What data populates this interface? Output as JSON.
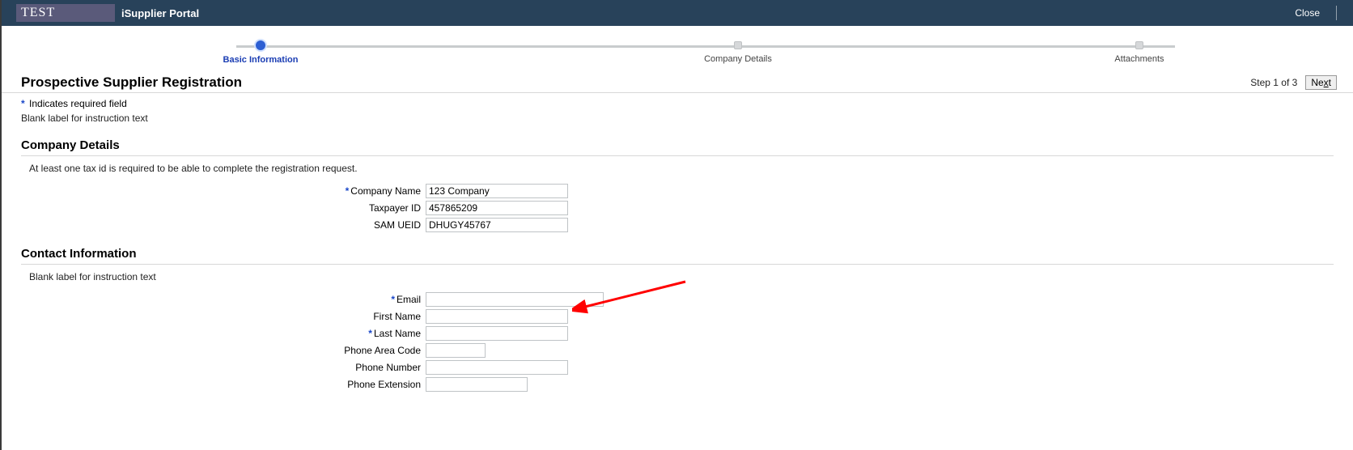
{
  "header": {
    "env_badge": "TEST",
    "portal_title": "iSupplier Portal",
    "close_label": "Close"
  },
  "progress": {
    "step1": "Basic Information",
    "step2": "Company Details",
    "step3": "Attachments"
  },
  "page": {
    "title": "Prospective Supplier Registration",
    "step_text": "Step 1 of 3",
    "next_label": "Next",
    "required_hint": "Indicates required field",
    "instruction_blank": "Blank label for instruction text"
  },
  "company": {
    "section_title": "Company Details",
    "note": "At least one tax id is required to be able to complete the registration request.",
    "labels": {
      "name": "Company Name",
      "taxpayer": "Taxpayer ID",
      "sam": "SAM UEID"
    },
    "values": {
      "name": "123 Company",
      "taxpayer": "457865209",
      "sam": "DHUGY45767"
    }
  },
  "contact": {
    "section_title": "Contact Information",
    "instruction_blank": "Blank label for instruction text",
    "labels": {
      "email": "Email",
      "first": "First Name",
      "last": "Last Name",
      "area": "Phone Area Code",
      "phone": "Phone Number",
      "ext": "Phone Extension"
    },
    "values": {
      "email": "",
      "first": "",
      "last": "",
      "area": "",
      "phone": "",
      "ext": ""
    }
  }
}
